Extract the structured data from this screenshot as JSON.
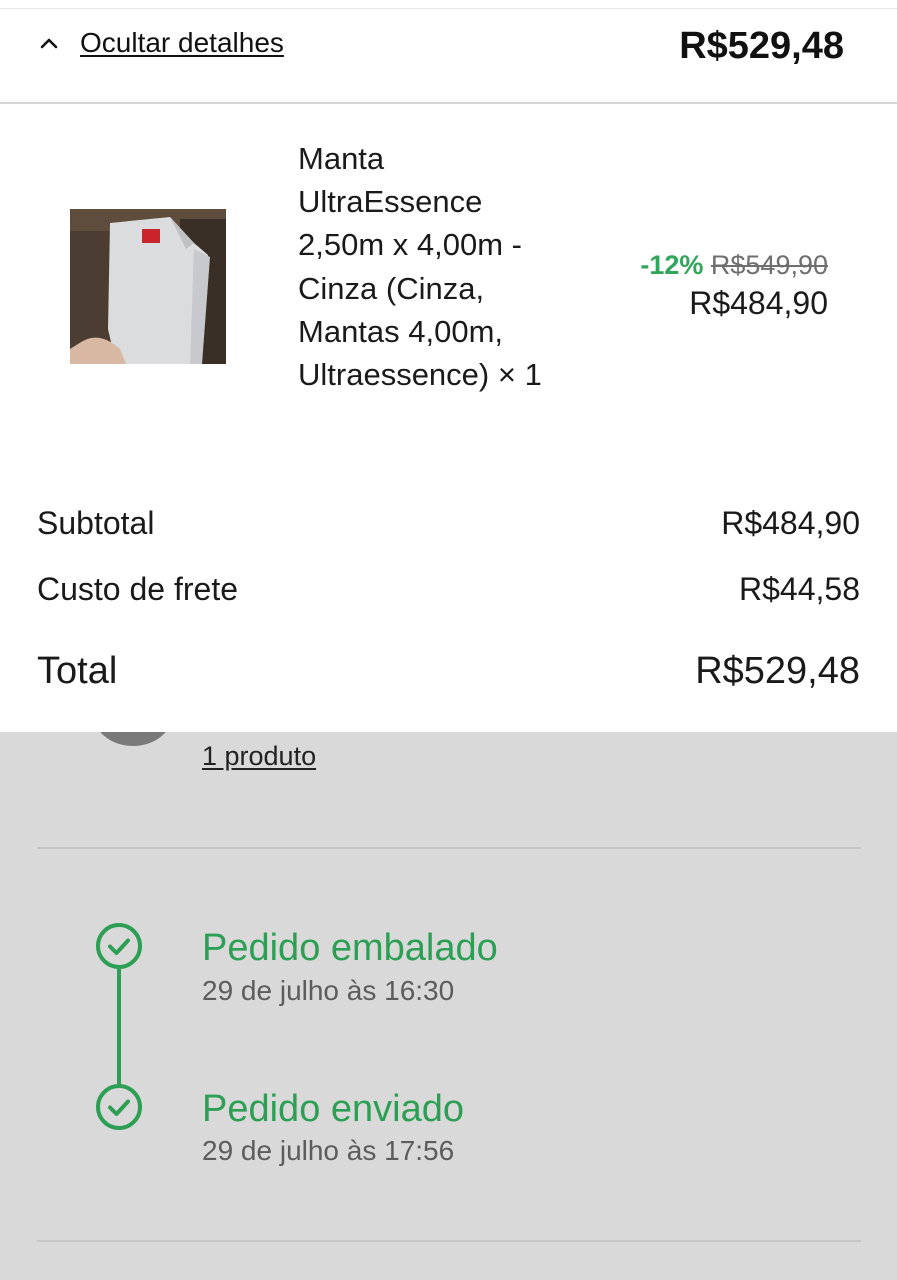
{
  "order_summary": {
    "toggle_label": "Ocultar detalhes",
    "total": "R$529,48"
  },
  "product": {
    "name": "Manta UltraEssence 2,50m x 4,00m - Cinza (Cinza, Mantas 4,00m, Ultraessence) × 1",
    "discount": "-12%",
    "original_price": "R$549,90",
    "price": "R$484,90"
  },
  "totals": {
    "subtotal_label": "Subtotal",
    "subtotal_value": "R$484,90",
    "shipping_label": "Custo de frete",
    "shipping_value": "R$44,58",
    "total_label": "Total",
    "total_value": "R$529,48"
  },
  "products_link": "1 produto",
  "timeline": [
    {
      "title": "Pedido embalado",
      "time": "29 de julho às 16:30"
    },
    {
      "title": "Pedido enviado",
      "time": "29 de julho às 17:56"
    }
  ],
  "colors": {
    "status_green": "#2c9f54",
    "discount_green": "#2fa65a",
    "background_grey": "#d9d9d9"
  },
  "icons": {
    "toggle": "chevron-up-icon",
    "timeline_step": "check-circle-icon"
  }
}
